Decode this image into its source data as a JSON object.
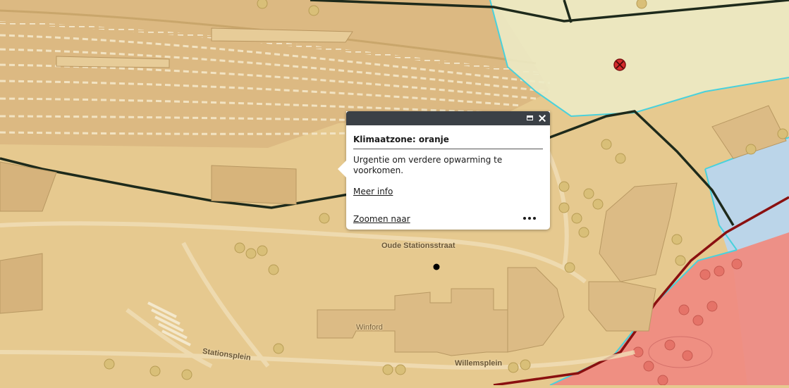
{
  "map": {
    "street_labels": {
      "oude_stationsstraat": "Oude Stationsstraat",
      "stationsplein": "Stationsplein",
      "willemsplein": "Willemsplein",
      "winford": "Winford"
    },
    "zone_colors": {
      "orange": "#e6c98f",
      "yellow": "#eceac4",
      "blue": "#b8d6ee",
      "red": "#ef8c82",
      "boundary_dark": "#1e2a1b",
      "boundary_red": "#8a1010",
      "boundary_cyan": "#49d1dc"
    },
    "markers": {
      "selected_point": "black-dot",
      "other_point": "red-cross-marker-icon"
    }
  },
  "popup": {
    "title": "Klimaatzone: oranje",
    "description": "Urgentie om verdere opwarming te voorkomen.",
    "more_info_link": "Meer info",
    "zoom_link": "Zoomen naar",
    "icons": {
      "maximize": "maximize-icon",
      "close": "close-icon",
      "more": "more-actions-icon"
    }
  }
}
